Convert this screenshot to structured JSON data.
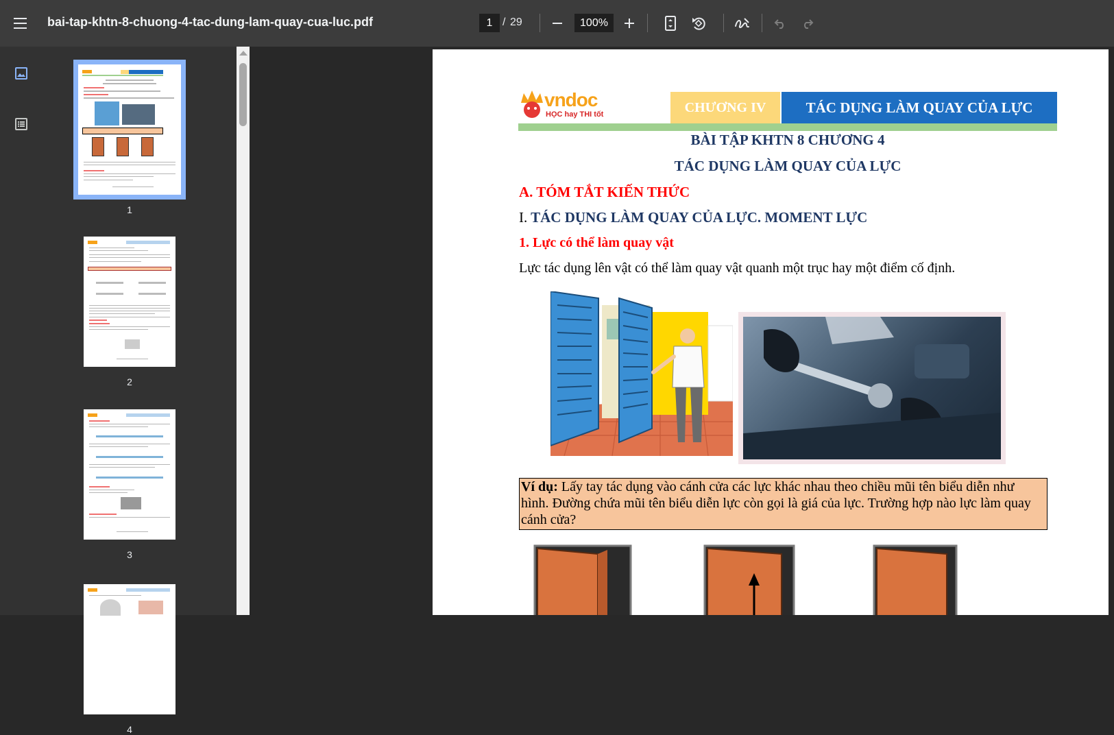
{
  "toolbar": {
    "filename": "bai-tap-khtn-8-chuong-4-tac-dung-lam-quay-cua-luc.pdf",
    "current_page": "1",
    "page_separator": "/",
    "total_pages": "29",
    "zoom": "100%"
  },
  "sidebar": {
    "thumbnails": [
      {
        "label": "1",
        "selected": true
      },
      {
        "label": "2",
        "selected": false
      },
      {
        "label": "3",
        "selected": false
      },
      {
        "label": "4",
        "selected": false
      }
    ]
  },
  "document": {
    "logo_text": "vndoc",
    "logo_tagline": "HỌC hay THI tốt",
    "header_chapter": "CHƯƠNG IV",
    "header_title": "TÁC DỤNG LÀM QUAY CỦA LỰC",
    "title_line1": "BÀI TẬP KHTN 8 CHƯƠNG 4",
    "title_line2": "TÁC DỤNG LÀM QUAY CỦA LỰC",
    "section_a": "A. TÓM TẮT KIẾN THỨC",
    "section_i_roman": "I.",
    "section_i": "TÁC DỤNG LÀM QUAY CỦA LỰC. MOMENT LỰC",
    "section_1": "1. Lực có thể làm quay vật",
    "paragraph": "Lực tác dụng lên vật có thể làm quay vật quanh một trục hay một điểm cố định.",
    "example_label": "Ví dụ:",
    "example_text": "Lấy tay tác dụng vào cánh cửa các lực khác nhau theo chiều mũi tên biểu diễn như hình. Đường chứa mũi tên biểu diễn lực còn gọi là giá của lực. Trường hợp nào lực làm quay cánh cửa?"
  },
  "colors": {
    "toolbar_bg": "#3c3c3c",
    "sidebar_bg": "#323232",
    "viewer_bg": "#282828",
    "selection": "#8ab4f8",
    "heading_red": "#ff0000",
    "heading_navy": "#1f3864",
    "chapter_yellow": "#fcd87a",
    "chapter_blue": "#1d6ec2",
    "example_bg": "#f7c59c"
  }
}
